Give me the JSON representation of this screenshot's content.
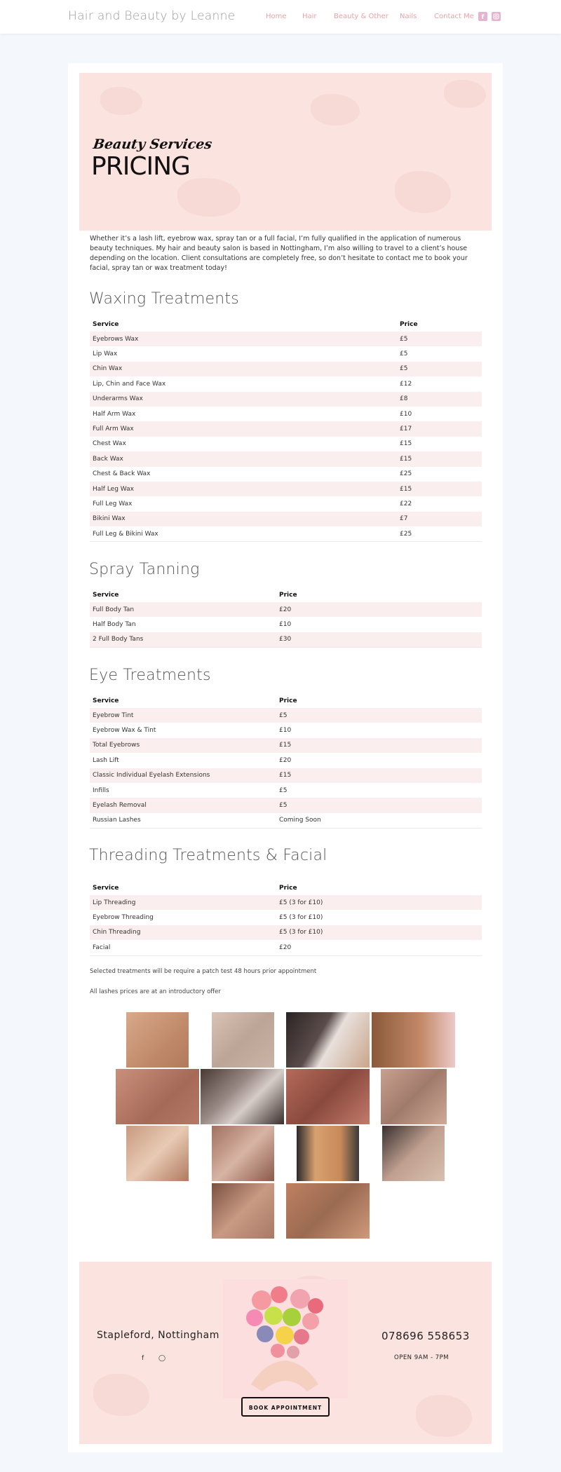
{
  "header": {
    "site_title": "Hair and Beauty by Leanne",
    "nav": [
      "Home",
      "Hair",
      "Beauty & Other",
      "Nails",
      "Contact Me"
    ],
    "social_icons": [
      "facebook-icon",
      "instagram-icon"
    ],
    "accent_color": "#e8a3a7"
  },
  "hero": {
    "subtitle": "Beauty Services",
    "title": "PRICING",
    "bg_color": "#fbe3df"
  },
  "intro": "Whether it’s a lash lift, eyebrow wax, spray tan or a full facial, I’m fully qualified in the application of numerous beauty techniques. My hair and beauty salon is based in Nottingham, I’m also willing to travel to a client’s house depending on the location. Client consultations are completely free, so don’t hesitate to contact me to book your facial, spray tan or wax treatment today!",
  "sections": [
    {
      "title": "Waxing Treatments",
      "headers": [
        "Service",
        "Price"
      ],
      "rows": [
        [
          "Eyebrows Wax",
          "£5"
        ],
        [
          "Lip Wax",
          "£5"
        ],
        [
          "Chin Wax",
          "£5"
        ],
        [
          "Lip, Chin and Face Wax",
          "£12"
        ],
        [
          "Underarms Wax",
          "£8"
        ],
        [
          "Half Arm Wax",
          "£10"
        ],
        [
          "Full Arm Wax",
          "£17"
        ],
        [
          "Chest Wax",
          "£15"
        ],
        [
          "Back Wax",
          "£15"
        ],
        [
          "Chest & Back Wax",
          "£25"
        ],
        [
          "Half Leg Wax",
          "£15"
        ],
        [
          "Full Leg Wax",
          "£22"
        ],
        [
          "Bikini Wax",
          "£7"
        ],
        [
          "Full Leg & Bikini Wax",
          "£25"
        ]
      ]
    },
    {
      "title": "Spray Tanning",
      "headers": [
        "Service",
        "Price"
      ],
      "rows": [
        [
          "Full Body Tan",
          "£20"
        ],
        [
          "Half Body Tan",
          "£10"
        ],
        [
          "2 Full Body Tans",
          "£30"
        ]
      ]
    },
    {
      "title": "Eye Treatments",
      "headers": [
        "Service",
        "Price"
      ],
      "rows": [
        [
          "Eyebrow Tint",
          "£5"
        ],
        [
          "Eyebrow Wax & Tint",
          "£10"
        ],
        [
          "Total Eyebrows",
          "£15"
        ],
        [
          "Lash Lift",
          "£20"
        ],
        [
          "Classic Individual Eyelash Extensions",
          "£15"
        ],
        [
          "Infills",
          "£5"
        ],
        [
          "Eyelash Removal",
          "£5"
        ],
        [
          "Russian Lashes",
          "Coming Soon"
        ]
      ]
    },
    {
      "title": "Threading Treatments & Facial",
      "headers": [
        "Service",
        "Price"
      ],
      "rows": [
        [
          "Lip Threading",
          "£5 (3 for £10)"
        ],
        [
          "Eyebrow Threading",
          "£5 (3 for £10)"
        ],
        [
          "Chin Threading",
          "£5 (3 for £10)"
        ],
        [
          "Facial",
          "£20"
        ]
      ]
    }
  ],
  "notes": [
    "Selected treatments will be require a patch test 48 hours prior appointment",
    "All lashes prices are at an introductory offer"
  ],
  "footer": {
    "location": "Stapleford, Nottingham",
    "phone": "07869​6 558653",
    "hours": "OPEN 9AM - 7PM",
    "button": "BOOK APPOINTMENT",
    "icons": [
      "facebook-icon",
      "instagram-icon"
    ]
  }
}
